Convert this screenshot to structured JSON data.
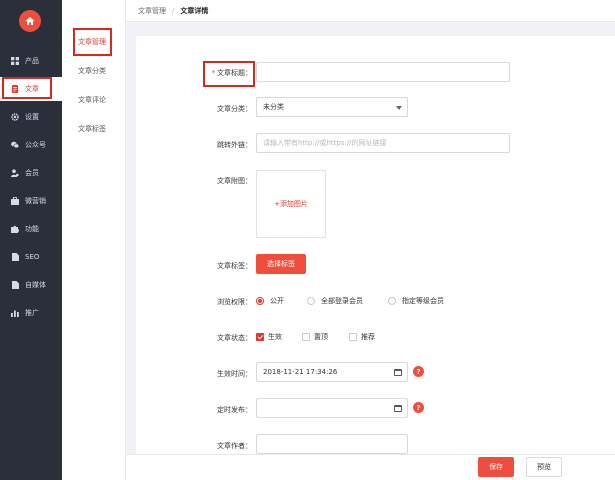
{
  "sidebar": {
    "items": [
      {
        "label": "产品",
        "icon": "grid-icon"
      },
      {
        "label": "文章",
        "icon": "document-icon"
      },
      {
        "label": "设置",
        "icon": "gear-icon"
      },
      {
        "label": "公众号",
        "icon": "wechat-icon"
      },
      {
        "label": "会员",
        "icon": "member-icon"
      },
      {
        "label": "微营销",
        "icon": "marketing-icon"
      },
      {
        "label": "功能",
        "icon": "puzzle-icon"
      },
      {
        "label": "SEO",
        "icon": "file-icon"
      },
      {
        "label": "自媒体",
        "icon": "file-icon"
      },
      {
        "label": "推广",
        "icon": "bar-chart-icon"
      }
    ]
  },
  "submenu": {
    "items": [
      "文章管理",
      "文章分类",
      "文章评论",
      "文章标签"
    ]
  },
  "breadcrumb": {
    "parent": "文章管理",
    "separator": "/",
    "current": "文章详情"
  },
  "form": {
    "title_label": "文章标题：",
    "required_mark": "*",
    "title_value": "",
    "category_label": "文章分类：",
    "category_value": "未分类",
    "link_label": "跳转外链：",
    "link_placeholder": "请输入带有http://或https://的网址链接",
    "attachment_label": "文章附图：",
    "add_image": "+添加图片",
    "tags_label": "文章标签：",
    "tags_button": "选择标签",
    "permission_label": "浏览权限：",
    "permission_options": [
      "公开",
      "全部登录会员",
      "指定等级会员"
    ],
    "permission_selected": "公开",
    "status_label": "文章状态：",
    "status_options": [
      {
        "label": "生效",
        "checked": true
      },
      {
        "label": "置顶",
        "checked": false
      },
      {
        "label": "推荐",
        "checked": false
      }
    ],
    "effective_time_label": "生效时间：",
    "effective_time_value": "2018-11-21 17:34:26",
    "scheduled_label": "定时发布：",
    "scheduled_value": "",
    "author_label": "文章作者："
  },
  "footer": {
    "save": "保存",
    "preview": "预览"
  },
  "colors": {
    "accent": "#f04e3c",
    "sidebar_bg": "#2b2f3a",
    "highlight_box": "#d9281e"
  }
}
